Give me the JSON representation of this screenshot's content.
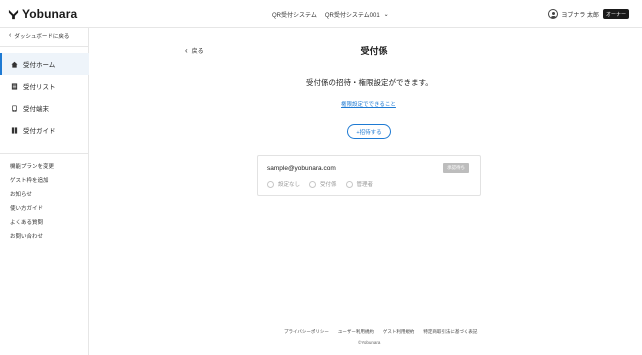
{
  "header": {
    "logo_text": "Yobunara",
    "system_label": "QR受付システム",
    "system_select": "QR受付システム001",
    "user_name": "ヨブナラ 太郎",
    "role_badge": "オーナー"
  },
  "sidebar": {
    "back_label": "ダッシュボードに戻る",
    "nav": [
      {
        "label": "受付ホーム",
        "icon": "home-icon",
        "active": true
      },
      {
        "label": "受付リスト",
        "icon": "list-icon",
        "active": false
      },
      {
        "label": "受付端末",
        "icon": "device-icon",
        "active": false
      },
      {
        "label": "受付ガイド",
        "icon": "guide-icon",
        "active": false
      }
    ],
    "links": [
      "機能プランを変更",
      "ゲスト枠を追加",
      "お知らせ",
      "使い方ガイド",
      "よくある質問",
      "お問い合わせ"
    ]
  },
  "main": {
    "back_label": "戻る",
    "title": "受付係",
    "description": "受付係の招待・権限設定ができます。",
    "permission_link": "権限設定でできること",
    "invite_button": "+招待する",
    "member": {
      "email": "sample@yobunara.com",
      "status": "承認待ち",
      "roles": [
        "設定なし",
        "受付係",
        "管理者"
      ]
    }
  },
  "footer": {
    "links": [
      "プライバシーポリシー",
      "ユーザー利用規約",
      "ゲスト利用規約",
      "特定商取引法に基づく表記"
    ],
    "copyright": "©Yobunara"
  },
  "colors": {
    "accent": "#1e7ad3",
    "active_bg": "#eef4fa",
    "badge_dark": "#1a1a1a",
    "status_gray": "#bdbdbd"
  }
}
